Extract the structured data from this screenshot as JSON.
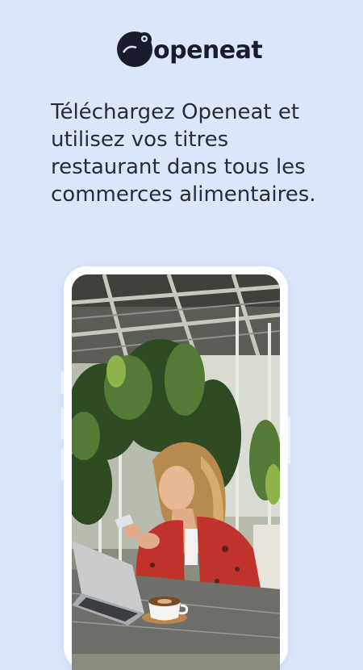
{
  "brand": {
    "name": "openeat"
  },
  "headline": "Téléchargez Openeat et utilisez vos titres restaurant dans tous les commerces alimentaires.",
  "colors": {
    "background": "#dce6fb",
    "brand_dark": "#1a1c2c",
    "text": "#2a2b33",
    "phone_frame": "#ffffff"
  },
  "icons": {
    "logo": "chameleon-logo-icon"
  }
}
